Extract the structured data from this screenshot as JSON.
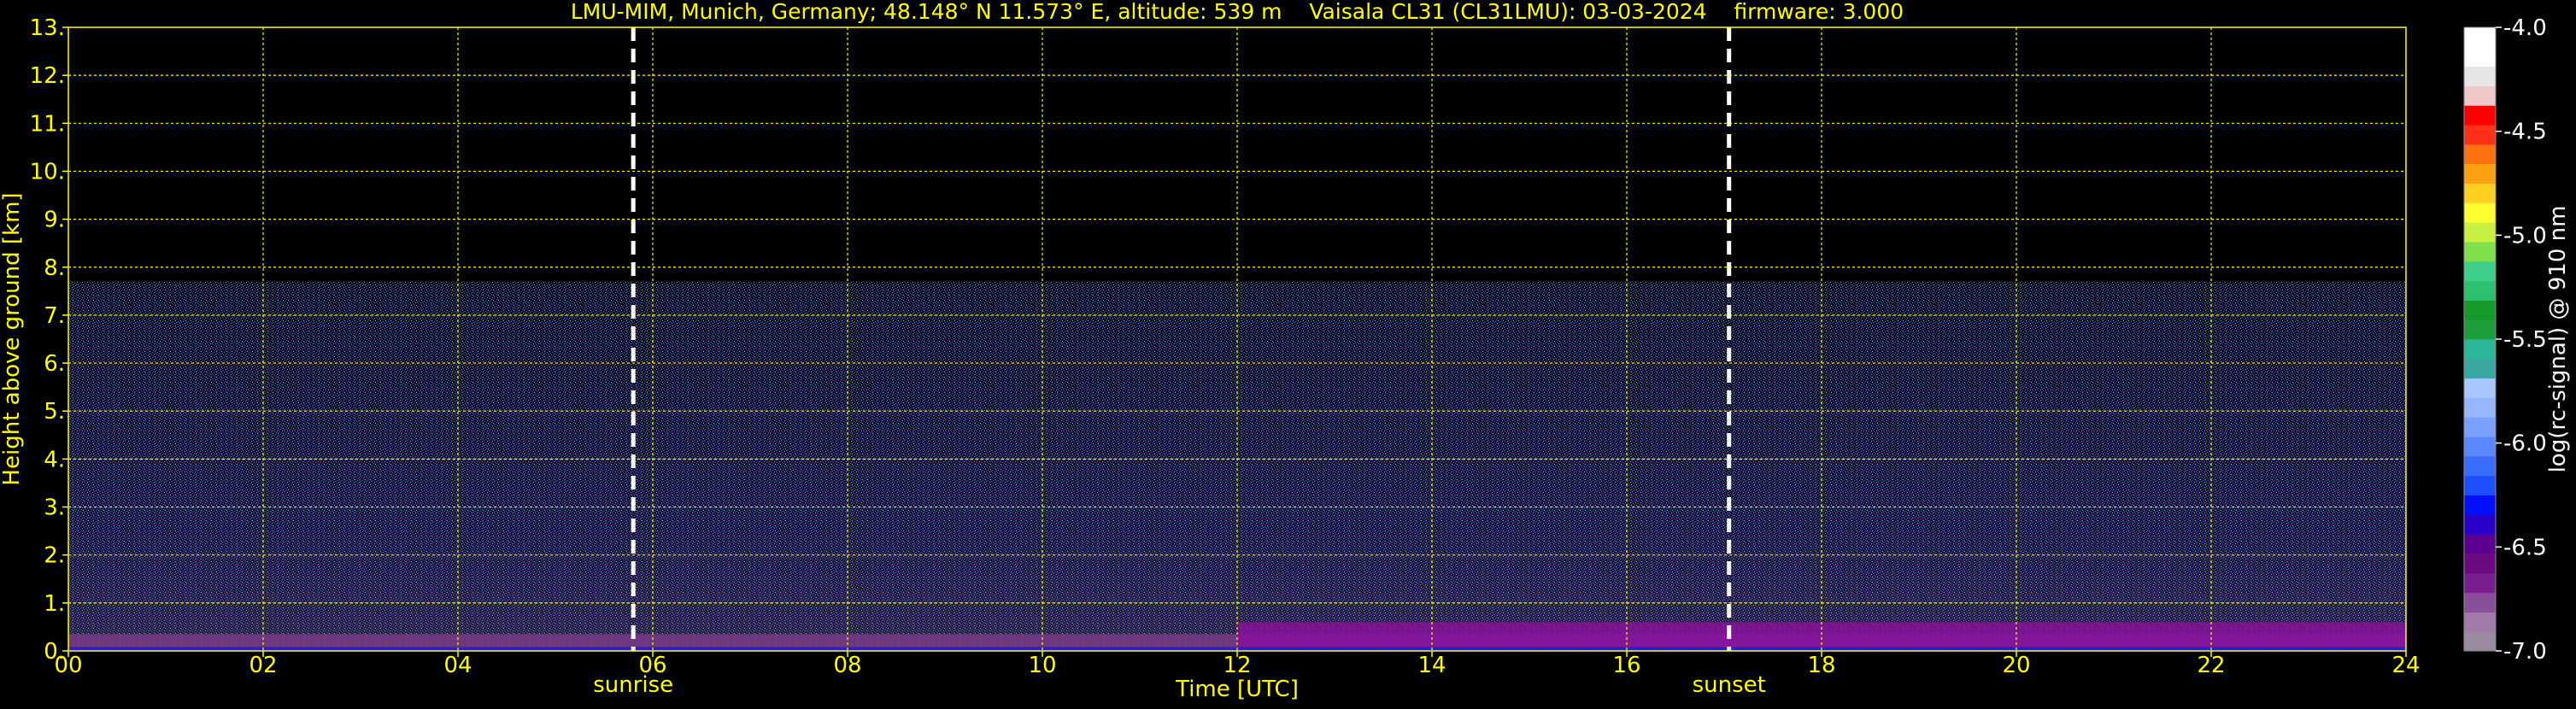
{
  "chart_data": {
    "type": "heatmap",
    "title": "LMU-MIM, Munich, Germany; 48.148° N 11.573° E, altitude: 539 m    Vaisala CL31 (CL31LMU): 03-03-2024    firmware: 3.000",
    "xlabel": "Time [UTC]",
    "ylabel": "Height above ground [km]",
    "xlim": [
      0,
      24
    ],
    "ylim": [
      0,
      13
    ],
    "x_ticks": [
      "00",
      "02",
      "04",
      "06",
      "08",
      "10",
      "12",
      "14",
      "16",
      "18",
      "20",
      "22",
      "24"
    ],
    "x_tick_values": [
      0,
      2,
      4,
      6,
      8,
      10,
      12,
      14,
      16,
      18,
      20,
      22,
      24
    ],
    "y_ticks": [
      "0.",
      "1.",
      "2.",
      "3.",
      "4.",
      "5.",
      "6.",
      "7.",
      "8.",
      "9.",
      "10.",
      "11.",
      "12.",
      "13."
    ],
    "y_tick_values": [
      0,
      1,
      2,
      3,
      4,
      5,
      6,
      7,
      8,
      9,
      10,
      11,
      12,
      13
    ],
    "grid": true,
    "grid_color": "#ffff00",
    "text_color": "#ffff00",
    "data_top_km": 7.7,
    "events": [
      {
        "label": "sunrise",
        "time": 5.8
      },
      {
        "label": "sunset",
        "time": 17.05
      }
    ],
    "colorbar": {
      "label": "log(rc-signal) @ 910 nm",
      "range": [
        -7.0,
        -4.0
      ],
      "ticks": [
        "-4.0",
        "-4.5",
        "-5.0",
        "-5.5",
        "-6.0",
        "-6.5",
        "-7.0"
      ],
      "tick_values": [
        -4.0,
        -4.5,
        -5.0,
        -5.5,
        -6.0,
        -6.5,
        -7.0
      ],
      "colors_low_to_high": [
        "#9a8aa0",
        "#a07aa8",
        "#8a4f9a",
        "#7a1f8f",
        "#6a0a80",
        "#5c0090",
        "#2a00c8",
        "#0010ff",
        "#1e4fff",
        "#3a6cff",
        "#5a86ff",
        "#7aa0ff",
        "#96b6ff",
        "#a8c6ff",
        "#3aa6a0",
        "#2bb898",
        "#1e9e3a",
        "#169a2a",
        "#2cc070",
        "#3dd08a",
        "#7fe04a",
        "#c8f040",
        "#ffff30",
        "#ffd020",
        "#ffa010",
        "#ff7010",
        "#ff3018",
        "#ff0000",
        "#f0c8c8",
        "#e6e6e6",
        "#ffffff",
        "#ffffff"
      ]
    }
  }
}
